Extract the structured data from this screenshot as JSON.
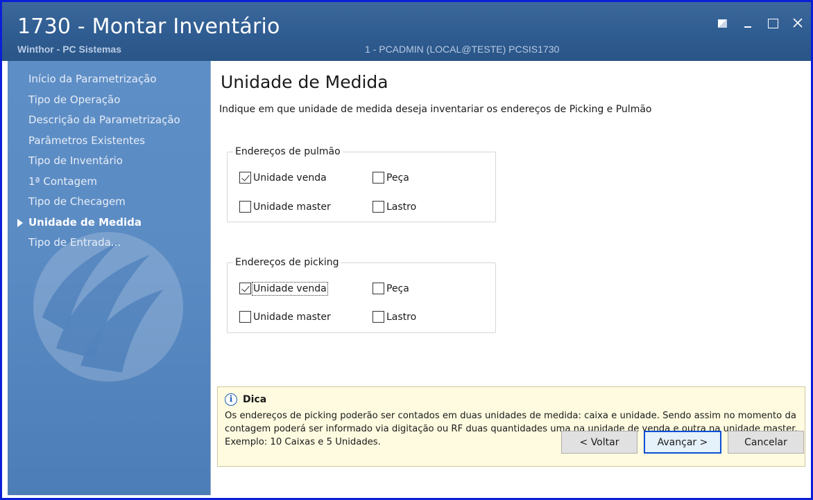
{
  "window": {
    "title": "1730 - Montar Inventário",
    "subtitle": "Winthor - PC Sistemas",
    "session": "1 - PCADMIN (LOCAL@TESTE)   PCSIS1730"
  },
  "sidebar": {
    "items": [
      {
        "label": "Início da Parametrização"
      },
      {
        "label": "Tipo de Operação"
      },
      {
        "label": "Descrição da Parametrização"
      },
      {
        "label": "Parâmetros Existentes"
      },
      {
        "label": "Tipo de Inventário"
      },
      {
        "label": "1ª Contagem"
      },
      {
        "label": "Tipo de Checagem"
      },
      {
        "label": "Unidade de Medida",
        "active": true
      },
      {
        "label": "Tipo de Entrada..."
      }
    ]
  },
  "main": {
    "title": "Unidade de Medida",
    "description": "Indique em que unidade de medida deseja inventariar os endereços de Picking e Pulmão",
    "groups": [
      {
        "legend": "Endereços de pulmão",
        "options": [
          {
            "label": "Unidade venda",
            "checked": true
          },
          {
            "label": "Peça",
            "checked": false
          },
          {
            "label": "Unidade master",
            "checked": false
          },
          {
            "label": "Lastro",
            "checked": false
          }
        ]
      },
      {
        "legend": "Endereços de picking",
        "options": [
          {
            "label": "Unidade venda",
            "checked": true
          },
          {
            "label": "Peça",
            "checked": false
          },
          {
            "label": "Unidade master",
            "checked": false
          },
          {
            "label": "Lastro",
            "checked": false
          }
        ]
      }
    ]
  },
  "tip": {
    "icon": "info-icon",
    "title": "Dica",
    "text": "Os endereços de picking poderão ser contados em duas unidades de medida: caixa e unidade. Sendo assim no momento da contagem poderá ser informado via digitação ou RF duas quantidades uma na unidade de venda e outra na unidade master. Exemplo: 10 Caixas e 5 Unidades."
  },
  "buttons": {
    "back": "< Voltar",
    "next": "Avançar >",
    "cancel": "Cancelar"
  },
  "colors": {
    "title_bar": "#2f5c91",
    "sidebar": "#5b8bc3",
    "window_border": "#0a1fd6",
    "tip_background": "#fffbe0"
  }
}
